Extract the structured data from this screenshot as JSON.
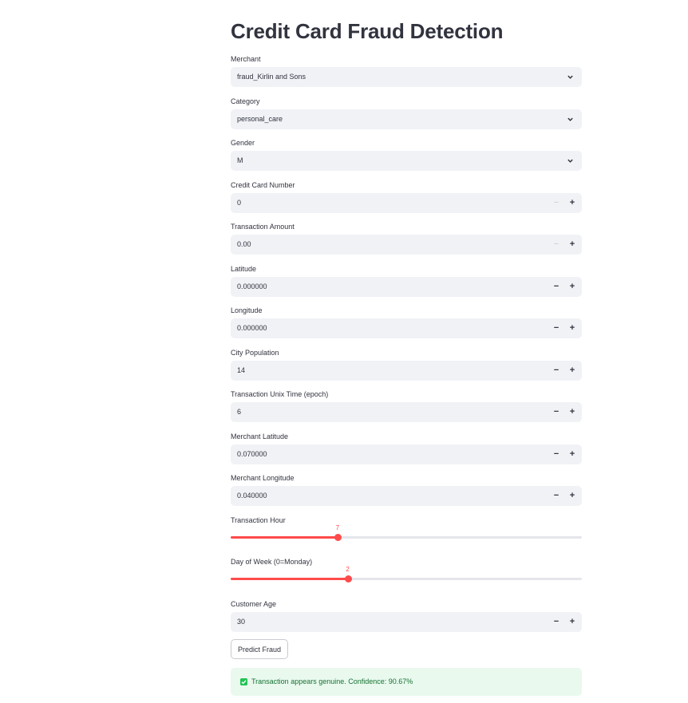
{
  "title": "Credit Card Fraud Detection",
  "fields": {
    "merchant": {
      "label": "Merchant",
      "value": "fraud_Kirlin and Sons"
    },
    "category": {
      "label": "Category",
      "value": "personal_care"
    },
    "gender": {
      "label": "Gender",
      "value": "M"
    },
    "cc_num": {
      "label": "Credit Card Number",
      "value": "0"
    },
    "amount": {
      "label": "Transaction Amount",
      "value": "0.00"
    },
    "lat": {
      "label": "Latitude",
      "value": "0.000000"
    },
    "long": {
      "label": "Longitude",
      "value": "0.000000"
    },
    "city_pop": {
      "label": "City Population",
      "value": "14"
    },
    "unix_time": {
      "label": "Transaction Unix Time (epoch)",
      "value": "6"
    },
    "merch_lat": {
      "label": "Merchant Latitude",
      "value": "0.070000"
    },
    "merch_long": {
      "label": "Merchant Longitude",
      "value": "0.040000"
    },
    "customer_age": {
      "label": "Customer Age",
      "value": "30"
    }
  },
  "sliders": {
    "hour": {
      "label": "Transaction Hour",
      "value": 7,
      "min": 0,
      "max": 23
    },
    "day_of_week": {
      "label": "Day of Week (0=Monday)",
      "value": 2,
      "min": 0,
      "max": 6
    }
  },
  "predict_button": "Predict Fraud",
  "result": {
    "message": "Transaction appears genuine. Confidence: 90.67%",
    "status_color": "#21c354"
  },
  "icons": {
    "select": "chevron-down-icon",
    "step_down": "minus-icon",
    "step_up": "plus-icon",
    "result": "check-box-icon"
  },
  "step_symbols": {
    "minus": "−",
    "plus": "+"
  },
  "colors": {
    "accent": "#ff4b4b",
    "input_bg": "#f0f2f6",
    "success_bg": "#e9f9ee",
    "text": "#31333f"
  }
}
